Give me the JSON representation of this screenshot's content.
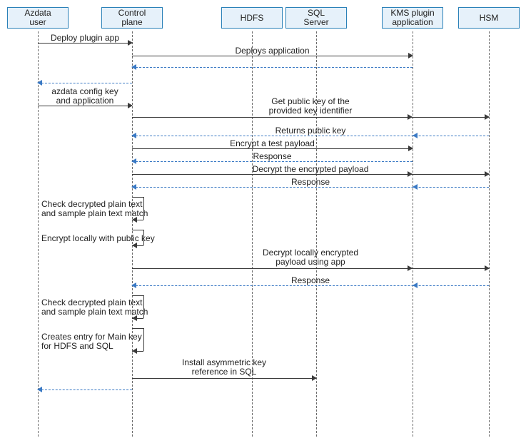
{
  "actors": {
    "azdata": "Azdata\nuser",
    "control": "Control\nplane",
    "hdfs": "HDFS",
    "sql": "SQL\nServer",
    "kms": "KMS plugin\napplication",
    "hsm": "HSM"
  },
  "messages": {
    "m1": "Deploy plugin app",
    "m2": "Deploys application",
    "m3": "azdata config key\nand application",
    "m4": "Get public key of the\nprovided key identifier",
    "m5": "Returns public key",
    "m6": "Encrypt a test payload",
    "m7": "Response",
    "m8": "Decrypt the encrypted payload",
    "m9": "Response",
    "n1": "Check decrypted plain text\nand sample plain text match",
    "n2": "Encrypt locally with public key",
    "m10": "Decrypt locally encrypted\npayload using app",
    "m11": "Response",
    "n3": "Check decrypted plain text\nand sample plain text match",
    "n4": "Creates entry for Main key\nfor HDFS and SQL",
    "m12": "Install asymmetric key\nreference in SQL"
  }
}
